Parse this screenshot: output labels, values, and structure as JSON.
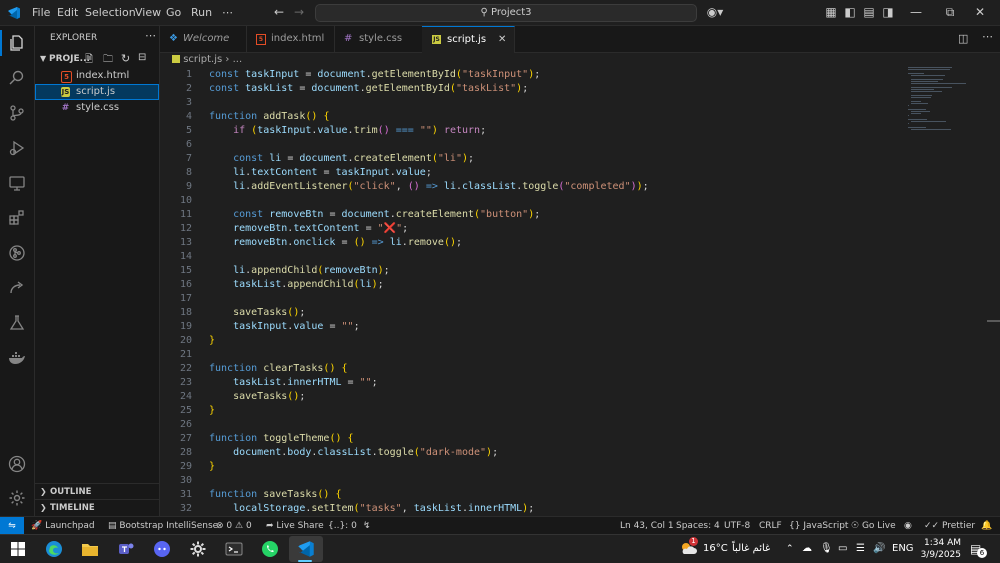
{
  "titlebar": {
    "menu": [
      "File",
      "Edit",
      "Selection",
      "View",
      "Go",
      "Run",
      "⋯"
    ],
    "command_center": "Project3",
    "colors": {
      "accent": "#0078d4"
    }
  },
  "sidebar": {
    "title": "EXPLORER",
    "project": "PROJE...",
    "files": [
      {
        "name": "index.html",
        "icon": "html-file-icon",
        "color": "#e44d26"
      },
      {
        "name": "script.js",
        "icon": "js-file-icon",
        "color": "#cbcb41",
        "selected": true
      },
      {
        "name": "style.css",
        "icon": "css-file-icon",
        "color": "#a074c4"
      }
    ],
    "outline": "OUTLINE",
    "timeline": "TIMELINE"
  },
  "tabs": [
    {
      "label": "Welcome",
      "icon": "vscode-icon",
      "active": false
    },
    {
      "label": "index.html",
      "icon": "html-file-icon",
      "active": false
    },
    {
      "label": "style.css",
      "icon": "css-file-icon",
      "active": false
    },
    {
      "label": "script.js",
      "icon": "js-file-icon",
      "active": true
    }
  ],
  "breadcrumb": {
    "file": "script.js",
    "rest": "..."
  },
  "editor": {
    "line_numbers": [
      "1",
      "2",
      "3",
      "4",
      "5",
      "6",
      "7",
      "8",
      "9",
      "10",
      "11",
      "12",
      "13",
      "14",
      "15",
      "16",
      "17",
      "18",
      "19",
      "20",
      "21",
      "22",
      "23",
      "24",
      "25",
      "26",
      "27",
      "28",
      "29",
      "30",
      "31",
      "32"
    ],
    "lines": [
      "const taskInput = document.getElementById(\"taskInput\");",
      "const taskList = document.getElementById(\"taskList\");",
      "",
      "function addTask() {",
      "    if (taskInput.value.trim() === \"\") return;",
      "",
      "    const li = document.createElement(\"li\");",
      "    li.textContent = taskInput.value;",
      "    li.addEventListener(\"click\", () => li.classList.toggle(\"completed\"));",
      "",
      "    const removeBtn = document.createElement(\"button\");",
      "    removeBtn.textContent = \"❌\";",
      "    removeBtn.onclick = () => li.remove();",
      "",
      "    li.appendChild(removeBtn);",
      "    taskList.appendChild(li);",
      "",
      "    saveTasks();",
      "    taskInput.value = \"\";",
      "}",
      "",
      "function clearTasks() {",
      "    taskList.innerHTML = \"\";",
      "    saveTasks();",
      "}",
      "",
      "function toggleTheme() {",
      "    document.body.classList.toggle(\"dark-mode\");",
      "}",
      "",
      "function saveTasks() {",
      "    localStorage.setItem(\"tasks\", taskList.innerHTML);"
    ]
  },
  "statusbar": {
    "launchpad": "Launchpad",
    "bootstrap": "Bootstrap IntelliSense",
    "errors": "0",
    "warnings": "0",
    "live_share": "Live Share",
    "braces": "{..}: 0",
    "position": "Ln 43, Col 1",
    "spaces": "Spaces: 4",
    "encoding": "UTF-8",
    "eol": "CRLF",
    "language": "JavaScript",
    "go_live": "Go Live",
    "prettier": "Prettier"
  },
  "taskbar": {
    "weather_badge": "1",
    "temperature": "16°C",
    "weather_text": "غائم غالباً",
    "language": "ENG",
    "time": "1:34 AM",
    "date": "3/9/2025",
    "notifications": "6"
  }
}
